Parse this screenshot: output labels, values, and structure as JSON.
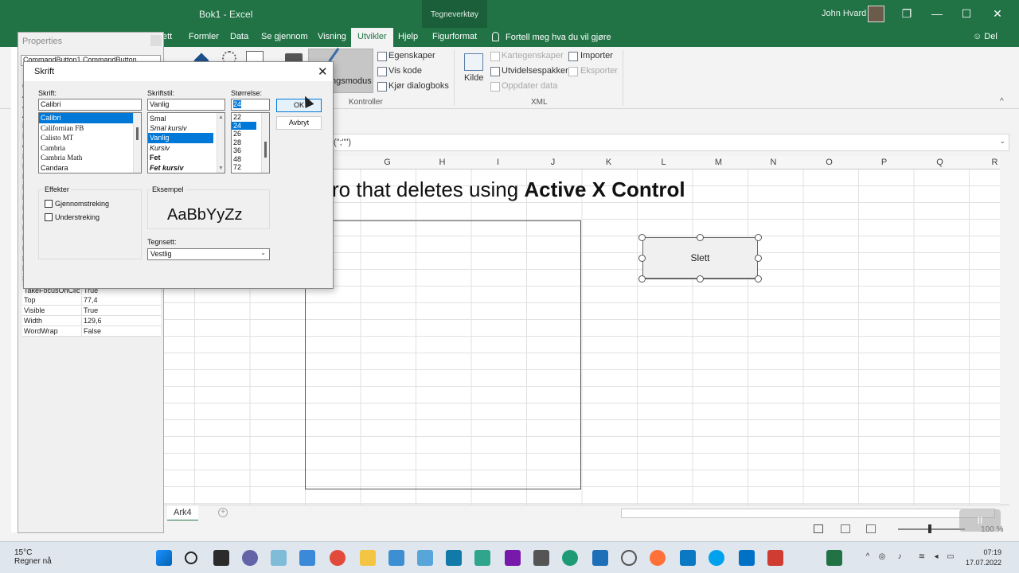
{
  "window": {
    "title": "Bok1  -  Excel",
    "context_tab": "Tegneverktøy",
    "user": "John Hvard",
    "controls": [
      "❐",
      "—",
      "☐",
      "✕"
    ]
  },
  "tabs": [
    {
      "label": "ett"
    },
    {
      "label": "Formler"
    },
    {
      "label": "Data"
    },
    {
      "label": "Se gjennom"
    },
    {
      "label": "Visning"
    },
    {
      "label": "Utvikler"
    },
    {
      "label": "Hjelp"
    },
    {
      "label": "Figurformat"
    }
  ],
  "tellme": "Fortell meg hva du vil gjøre",
  "share": "Del",
  "ribbon": {
    "design_mode": "ngsmodus",
    "controls_items": [
      "Egenskaper",
      "Vis kode",
      "Kjør dialogboks"
    ],
    "controls_group": "Kontroller",
    "xml_source": "Kilde",
    "xml_items_left": [
      "Kartegenskaper",
      "Utvidelsespakker",
      "Oppdater data"
    ],
    "xml_items_right": [
      "Importer",
      "Eksporter"
    ],
    "xml_group": "XML",
    "collapse": "^"
  },
  "formula_bar": {
    "text": "(\";\"\")",
    "dropdown": "⌄"
  },
  "columns": [
    "G",
    "H",
    "I",
    "J",
    "K",
    "L",
    "M",
    "N",
    "O",
    "P",
    "Q",
    "R"
  ],
  "sheet": {
    "heading_plain": "ro that deletes using ",
    "heading_bold": "Active X Control",
    "button_label": "Slett",
    "sheet_tab": "Ark4",
    "add_sheet": "+",
    "zoom": "100 %"
  },
  "properties": {
    "title": "Properties",
    "object_combo": "CommandButton1  CommandButton",
    "rows": [
      {
        "key": "TakeFocusOnClick",
        "value": "True"
      },
      {
        "key": "Top",
        "value": "77,4"
      },
      {
        "key": "Visible",
        "value": "True"
      },
      {
        "key": "Width",
        "value": "129,6"
      },
      {
        "key": "WordWrap",
        "value": "False"
      }
    ],
    "left_letters": [
      "(N",
      "Ac",
      "Ac",
      "Au",
      "Ba",
      "Ba",
      "Ca",
      "En",
      "Fo",
      "Fo",
      "He",
      "Le",
      "Lo",
      "Ma",
      "Mo",
      "Pi",
      "Pi",
      "Pla",
      "Pr",
      "Sh"
    ]
  },
  "font_dialog": {
    "title": "Skrift",
    "close": "✕",
    "font_label": "Skrift:",
    "font_value": "Calibri",
    "fonts": [
      "Calibri",
      "Californian FB",
      "Calisto MT",
      "Cambria",
      "Cambria Math",
      "Candara"
    ],
    "style_label": "Skriftstil:",
    "style_value": "Vanlig",
    "styles": [
      "Smal",
      "Smal kursiv",
      "Vanlig",
      "Kursiv",
      "Fet",
      "Fet kursiv"
    ],
    "size_label": "Størrelse:",
    "size_value": "24",
    "sizes": [
      "22",
      "24",
      "26",
      "28",
      "36",
      "48",
      "72"
    ],
    "ok": "OK",
    "cancel": "Avbryt",
    "effects_label": "Effekter",
    "strikethrough": "Gjennomstreking",
    "underline": "Understreking",
    "sample_label": "Eksempel",
    "sample_text": "AaBbYyZz",
    "charset_label": "Tegnsett:",
    "charset_value": "Vestlig"
  },
  "taskbar": {
    "temperature": "15°C",
    "weather": "Regner nå",
    "time": "07:19",
    "date": "17.07.2022"
  },
  "video": {
    "pause": "II",
    "next": "▶"
  },
  "colors": {
    "excel_green": "#217346",
    "selection": "#0078d7"
  }
}
